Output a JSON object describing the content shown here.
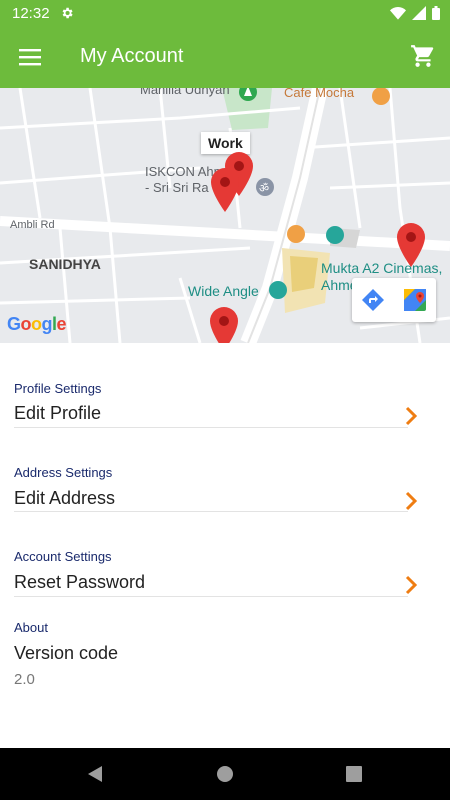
{
  "status_bar": {
    "time": "12:32"
  },
  "app_bar": {
    "title": "My Account"
  },
  "map": {
    "labels": {
      "manilla": "Manilla Udhyan",
      "cafe": "Cafe Mocha",
      "iskcon_1": "ISKCON Ahmeda",
      "iskcon_2": "- Sri Sri Ra",
      "ambli": "Ambli Rd",
      "sanidhya": "SANIDHYA",
      "mukta_1": "Mukta A2 Cinemas,",
      "mukta_2": "Ahmedabad",
      "wide_angle": "Wide Angle"
    },
    "callout": "Work",
    "logo": "Google"
  },
  "sections": {
    "profile": {
      "label": "Profile Settings",
      "value": "Edit Profile"
    },
    "address": {
      "label": "Address Settings",
      "value": "Edit Address"
    },
    "account": {
      "label": "Account Settings",
      "value": "Reset Password"
    },
    "about": {
      "label": "About",
      "value": "Version code",
      "version": "2.0"
    }
  },
  "colors": {
    "primary": "#6dbb3c",
    "accent": "#ef7d12",
    "pin": "#e53935"
  }
}
